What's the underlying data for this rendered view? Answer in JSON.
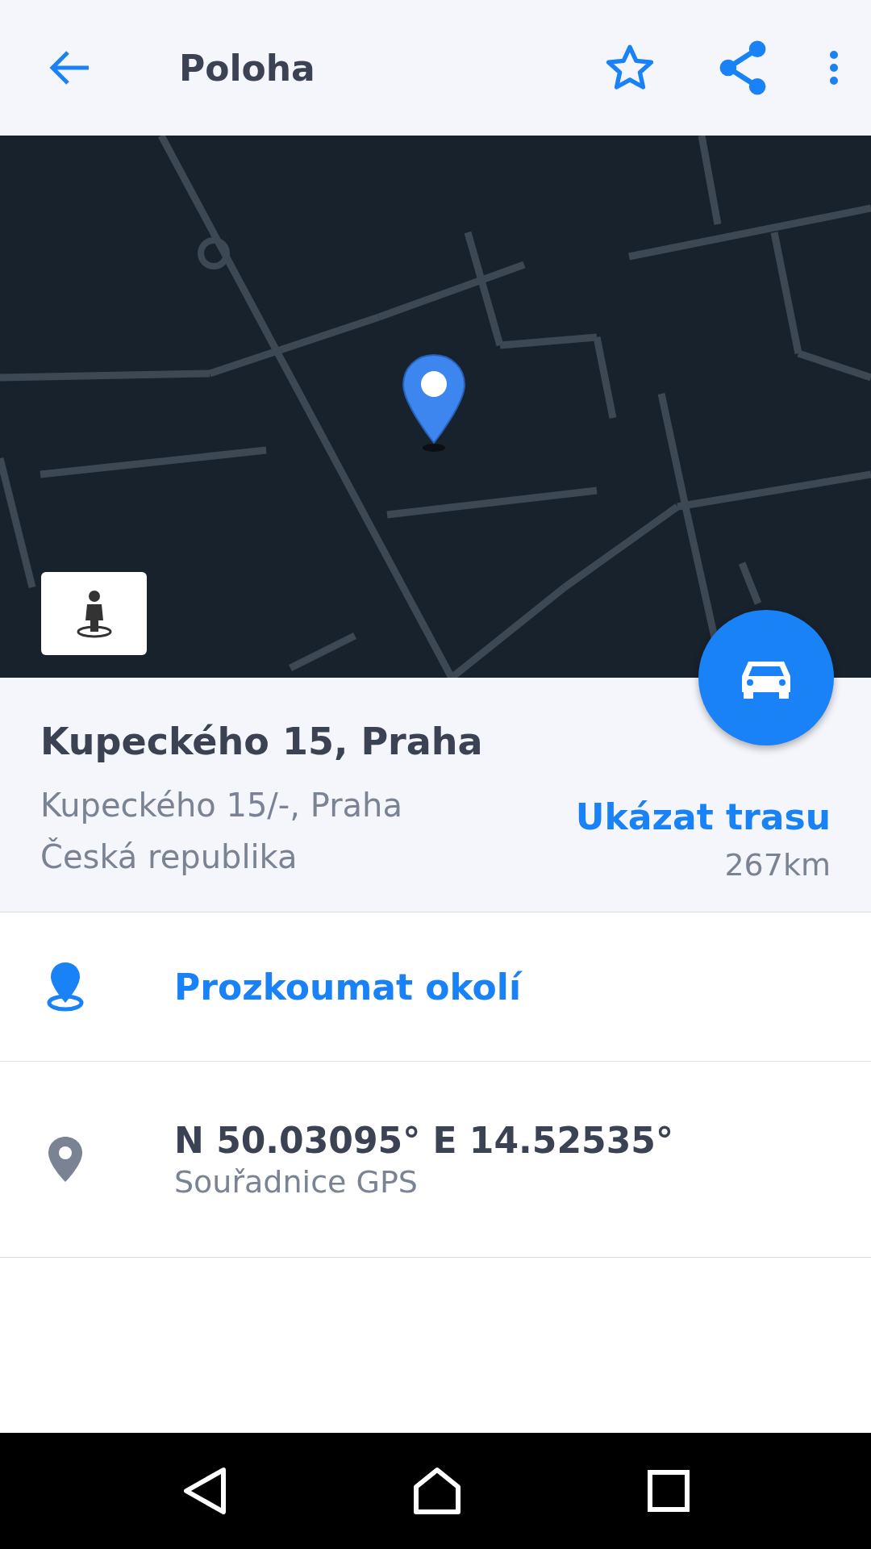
{
  "app_bar": {
    "title": "Poloha"
  },
  "place": {
    "title": "Kupeckého 15, Praha",
    "address_line": "Kupeckého 15/-, Praha",
    "country": "Česká republika",
    "route_link": "Ukázat trasu",
    "distance": "267km"
  },
  "actions": [
    {
      "kind": "link",
      "label": "Prozkoumat okolí"
    },
    {
      "kind": "info",
      "title": "N 50.03095° E 14.52535°",
      "subtitle": "Souřadnice GPS"
    }
  ]
}
